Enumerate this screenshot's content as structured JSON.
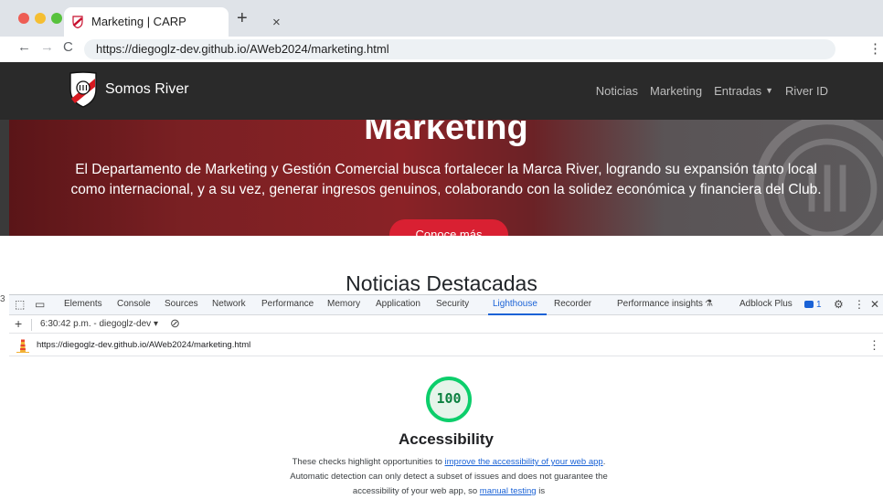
{
  "browser": {
    "tab_title": "Marketing | CARP",
    "tab_close": "×",
    "new_tab": "+",
    "back": "←",
    "forward": "→",
    "reload": "C",
    "url": "https://diegoglz-dev.github.io/AWeb2024/marketing.html",
    "menu": "⋮"
  },
  "site": {
    "brand": "Somos River",
    "nav": [
      {
        "label": "Noticias"
      },
      {
        "label": "Marketing"
      },
      {
        "label": "Entradas"
      },
      {
        "label": "River ID"
      }
    ],
    "hero": {
      "title": "Marketing",
      "text": "El Departamento de Marketing y Gestión Comercial busca fortalecer la Marca River, logrando su expansión tanto local como internacional, y a su vez, generar ingresos genuinos, colaborando con la solidez económica y financiera del Club.",
      "button": "Conoce más"
    },
    "section_title": "Noticias Destacadas",
    "gutter_mark": "3",
    "colors": {
      "navbar": "#2a2a2a",
      "accent": "#d92032",
      "hero_red": "#8a2226"
    }
  },
  "devtools": {
    "tabs": [
      {
        "label": "Elements"
      },
      {
        "label": "Console"
      },
      {
        "label": "Sources"
      },
      {
        "label": "Network"
      },
      {
        "label": "Performance"
      },
      {
        "label": "Memory"
      },
      {
        "label": "Application"
      },
      {
        "label": "Security"
      },
      {
        "label": "Lighthouse"
      },
      {
        "label": "Recorder"
      },
      {
        "label": "Performance insights"
      },
      {
        "label": "Adblock Plus"
      }
    ],
    "active_tab": "Lighthouse",
    "issues_count": "1",
    "report_label": "6:30:42 p.m. - diegoglz-dev",
    "lighthouse": {
      "url": "https://diegoglz-dev.github.io/AWeb2024/marketing.html",
      "score": "100",
      "score_fraction": 1.0,
      "category": "Accessibility",
      "desc_1": "These checks highlight opportunities to ",
      "desc_link_1": "improve the accessibility of your web app",
      "desc_2": ". Automatic detection can only detect a subset of issues and does not guarantee the accessibility of your web app, so ",
      "desc_link_2": "manual testing",
      "desc_3": " is",
      "pass_color": "#0c8040"
    }
  }
}
